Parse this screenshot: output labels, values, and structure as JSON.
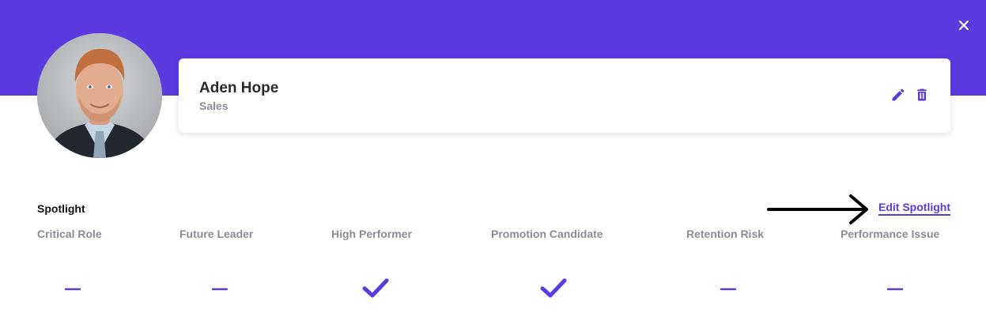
{
  "header": {
    "banner_color": "#5b3be0",
    "close_icon": "close-icon"
  },
  "profile": {
    "name": "Aden Hope",
    "department": "Sales",
    "avatar": "profile-photo",
    "actions": [
      {
        "icon": "pencil-icon",
        "action": "edit"
      },
      {
        "icon": "trash-icon",
        "action": "delete"
      }
    ]
  },
  "spotlight": {
    "title": "Spotlight",
    "edit_label": "Edit Spotlight",
    "accent_color": "#5b3be0",
    "columns": [
      {
        "label": "Critical Role",
        "status": "none"
      },
      {
        "label": "Future Leader",
        "status": "none"
      },
      {
        "label": "High Performer",
        "status": "checked"
      },
      {
        "label": "Promotion Candidate",
        "status": "checked"
      },
      {
        "label": "Retention Risk",
        "status": "none"
      },
      {
        "label": "Performance Issue",
        "status": "none"
      }
    ]
  }
}
